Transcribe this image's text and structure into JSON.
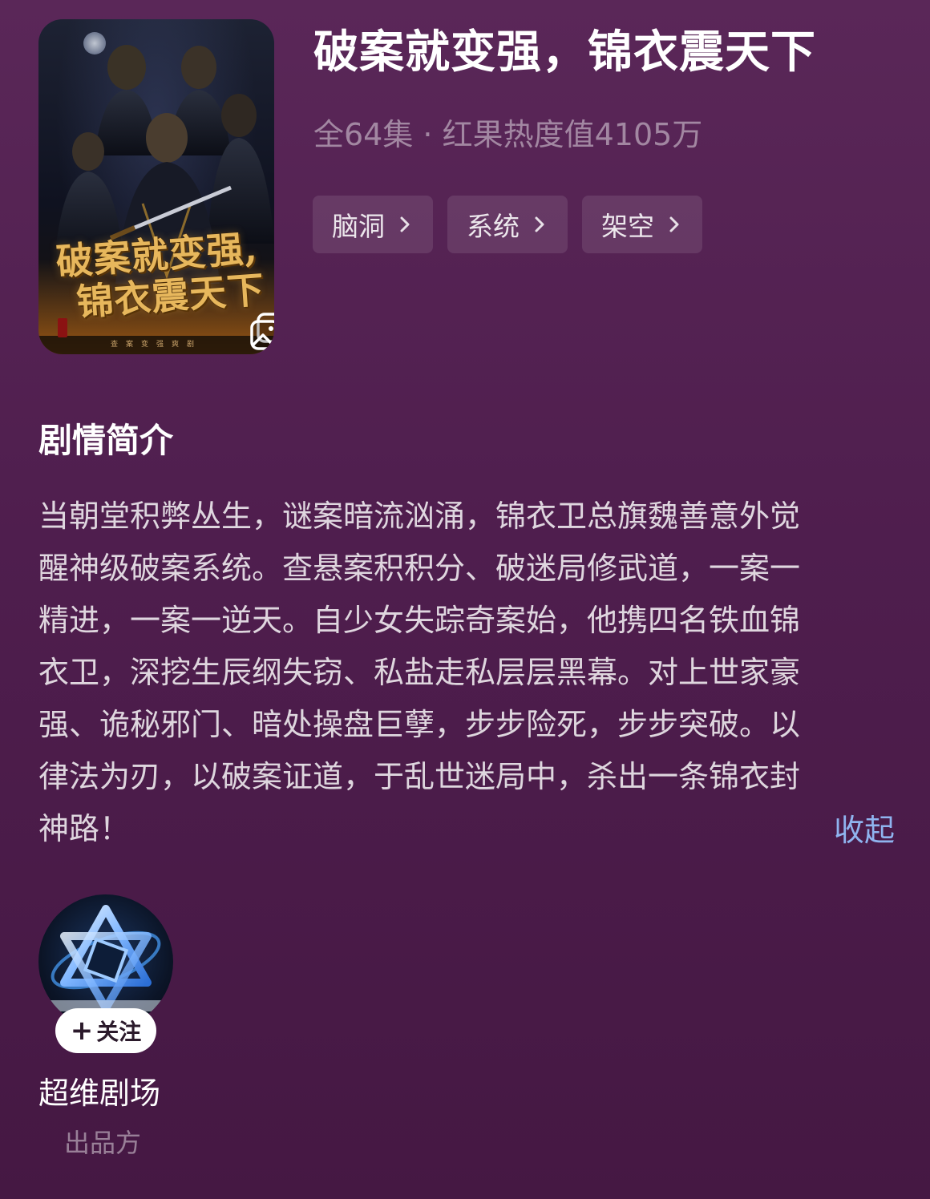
{
  "show": {
    "title": "破案就变强，锦衣震天下",
    "meta": "全64集 · 红果热度值4105万",
    "tags": [
      {
        "label": "脑洞"
      },
      {
        "label": "系统"
      },
      {
        "label": "架空"
      }
    ],
    "poster": {
      "title_line1": "破案就变强,",
      "title_line2": "锦衣震天下",
      "tagline": "查案变强爽剧",
      "gallery_icon": "gallery-icon"
    }
  },
  "synopsis": {
    "heading": "剧情简介",
    "lines": [
      "当朝堂积弊丛生，谜案暗流汹涌，锦衣卫总旗魏善意外觉",
      "醒神级破案系统。查悬案积积分、破迷局修武道，一案一",
      "精进，一案一逆天。自少女失踪奇案始，他携四名铁血锦",
      "衣卫，深挖生辰纲失窃、私盐走私层层黑幕。对上世家豪",
      "强、诡秘邪门、暗处操盘巨孽，步步险死，步步突破。以",
      "律法为刃，以破案证道，于乱世迷局中，杀出一条锦衣封",
      "神路！"
    ],
    "collapse_label": "收起"
  },
  "producer": {
    "follow_label": "关注",
    "name": "超维剧场",
    "role": "出品方"
  },
  "colors": {
    "background_top": "#5a2758",
    "background_bottom": "#451843",
    "link": "#8fb4ef",
    "poster_title_gold": "#e7b75c"
  }
}
